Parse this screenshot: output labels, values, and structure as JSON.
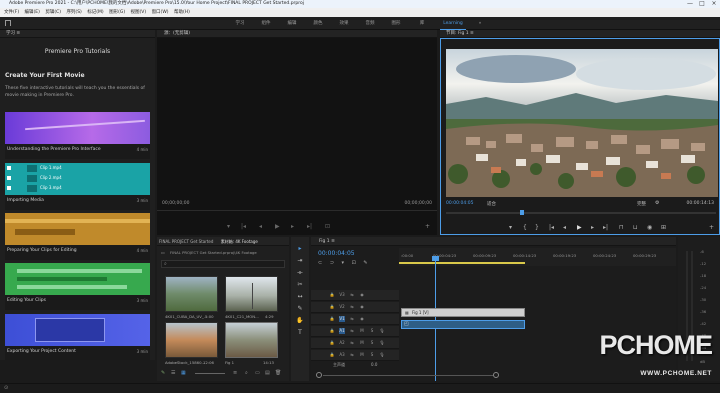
{
  "titlebar": {
    "text": "Adobe Premiere Pro 2021 - C:\\用户\\PCHOME\\我的文档\\Adobe\\Premiere Pro\\15.0\\Your Home Project\\FINAL PROJECT Get Started.prproj",
    "min": "—",
    "max": "□",
    "close": "×"
  },
  "menu": [
    "文件(F)",
    "编辑(E)",
    "剪辑(C)",
    "序列(S)",
    "标记(M)",
    "图形(G)",
    "视图(V)",
    "窗口(W)",
    "帮助(H)"
  ],
  "workspaces": [
    "学习",
    "组件",
    "编辑",
    "颜色",
    "效果",
    "音频",
    "图形",
    "库",
    "Learning"
  ],
  "workspace_more": "»",
  "learn_panel": {
    "tab": "学习 ≡",
    "title": "Premiere Pro Tutorials",
    "heading": "Create Your First Movie",
    "desc": "These five interactive tutorials will teach you the essentials of movie making in Premiere Pro.",
    "cards": [
      {
        "label": "Understanding the Premiere Pro Interface",
        "dur": "4 min"
      },
      {
        "label": "Importing Media",
        "dur": "3 min",
        "clips": [
          "Clip 1.mp4",
          "Clip 2.mp4",
          "Clip 3.mp4"
        ]
      },
      {
        "label": "Preparing Your Clips for Editing",
        "dur": "4 min"
      },
      {
        "label": "Editing Your Clips",
        "dur": "3 min"
      },
      {
        "label": "Exporting Your Project Content",
        "dur": "3 min"
      }
    ]
  },
  "source_panel": {
    "tab": "源：(无剪辑)",
    "tc_left": "00;00;00;00",
    "tc_right": "00;00;00;00"
  },
  "program_panel": {
    "tab": "节目: Fig 1 ≡",
    "tc_left": "00:00:04:05",
    "fit": "适合",
    "quality": "完整",
    "tc_right": "00:00:14:13"
  },
  "project_panel": {
    "tab1": "FINAL PROJECT Get Started",
    "tab2": "素材箱: 4K Footage",
    "path": "FINAL PROJECT Get Started.prproj\\4K Footage",
    "clips": [
      {
        "name": "4K01_CUBA_DA_UV_...",
        "dur": "5:00"
      },
      {
        "name": "4K01_C21_MON...",
        "dur": "4:29"
      },
      {
        "name": "AdobeStock_15860...",
        "dur": "12:06"
      },
      {
        "name": "Fig 1",
        "dur": "14:13"
      }
    ]
  },
  "timeline": {
    "tab": "Fig 1 ≡",
    "tc": "00:00:04:05",
    "ruler": [
      ":00:00",
      "00:00:04:23",
      "00:00:09:23",
      "00:00:14:23",
      "00:00:19:23",
      "00:00:24:23",
      "00:00:29:23"
    ],
    "tracks": [
      "V3",
      "V2",
      "V1",
      "A1",
      "A2",
      "A3"
    ],
    "clip_label": "Fig 1 [V]",
    "master": "主声道",
    "master_val": "0.0"
  },
  "meter": {
    "labels": [
      "-6",
      "-12",
      "-18",
      "-24",
      "-30",
      "-36",
      "-42",
      "-48",
      "-54"
    ],
    "bottom": "dB"
  },
  "watermark": {
    "brand": "PCHOME",
    "url": "WWW.PCHOME.NET"
  }
}
